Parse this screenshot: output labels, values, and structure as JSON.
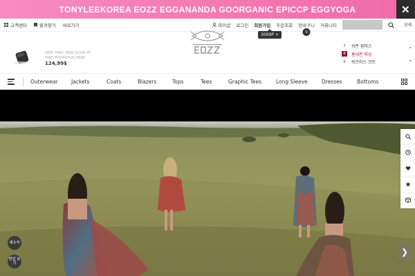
{
  "banner": {
    "text": "TONYLEEKOREA EOZZ EGGANANDA GOORGANIC EPICCP EGGYOGA",
    "close": "✕"
  },
  "util_left": [
    {
      "label": "고객센터",
      "icon": "grid-icon"
    },
    {
      "label": "즐겨찾기",
      "icon": "bookmark-icon"
    },
    {
      "label": "바로가기",
      "icon": ""
    }
  ],
  "util_right": {
    "mypage": "마이샵",
    "login": "로그인",
    "join": "회원가입",
    "orders": "주문조회",
    "cart": "장바구니",
    "cart_count": "0",
    "community": "커뮤니티",
    "detail": "상세"
  },
  "tooltip": "3000P +",
  "promo": {
    "text": "NEW YEAR, NEW GLOW AT PIND HYDRATION HERE",
    "price": "124,99$"
  },
  "rank": [
    {
      "num": "7",
      "label": "쉬폰 원피스",
      "highlight": false
    },
    {
      "num": "8",
      "label": "홈데몬 파딩",
      "highlight": true
    },
    {
      "num": "9",
      "label": "쉬즈미스 코트",
      "highlight": false
    }
  ],
  "nav": [
    "Outerwear",
    "Jackets",
    "Coats",
    "Blazers",
    "Tops",
    "Tees",
    "Graphic Tees",
    "Long Sleeve",
    "Dresses",
    "Bottoms"
  ],
  "floating": {
    "btn1": "새소식",
    "btn2": "방업 보기"
  },
  "colors": {
    "banner": "#f47ab2",
    "rank_highlight": "#c0183a"
  }
}
